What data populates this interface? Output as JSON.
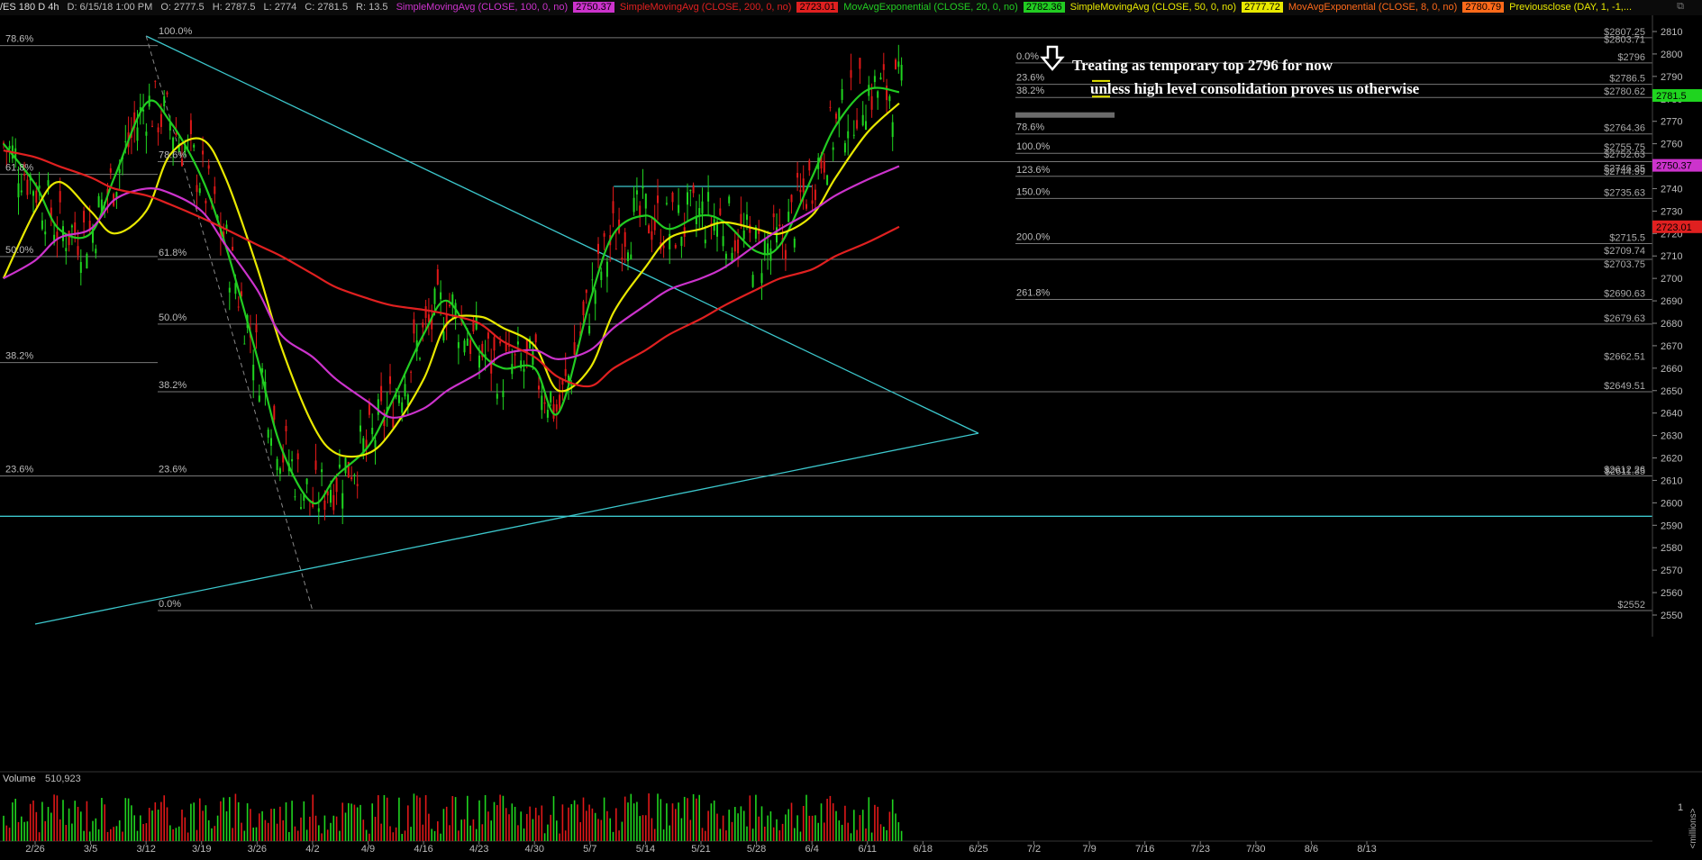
{
  "header": {
    "symbol": "/ES 180 D 4h",
    "date": "D: 6/15/18 1:00 PM",
    "open": "O: 2777.5",
    "high": "H: 2787.5",
    "low": "L: 2774",
    "close": "C: 2781.5",
    "range": "R: 13.5",
    "studies": [
      {
        "label": "SimpleMovingAvg (CLOSE, 100, 0, no)",
        "value": "2750.37",
        "color": "#cc33cc"
      },
      {
        "label": "SimpleMovingAvg (CLOSE, 200, 0, no)",
        "value": "2723.01",
        "color": "#e02020"
      },
      {
        "label": "MovAvgExponential (CLOSE, 20, 0, no)",
        "value": "2782.36",
        "color": "#22cc22"
      },
      {
        "label": "SimpleMovingAvg (CLOSE, 50, 0, no)",
        "value": "2777.72",
        "color": "#e8e800"
      },
      {
        "label": "MovAvgExponential (CLOSE, 8, 0, no)",
        "value": "2780.79",
        "color": "#ff6a1a"
      },
      {
        "label": "Previousclose (DAY, 1, -1,...",
        "value": "",
        "color": "#e8e800"
      }
    ]
  },
  "annotations": {
    "line1": "Treating as temporary top 2796 for now",
    "line2": "unless high level consolidation proves us otherwise"
  },
  "chart_data": {
    "type": "candlestick",
    "symbol": "/ES",
    "timeframe": "180 D 4h",
    "ylim": [
      2545,
      2812
    ],
    "ohlc_last": {
      "open": 2777.5,
      "high": 2787.5,
      "low": 2774,
      "close": 2781.5,
      "range": 13.5
    },
    "y_ticks": [
      2550,
      2560,
      2570,
      2580,
      2590,
      2600,
      2610,
      2620,
      2630,
      2640,
      2650,
      2660,
      2670,
      2680,
      2690,
      2700,
      2710,
      2720,
      2730,
      2740,
      2750,
      2760,
      2770,
      2780,
      2790,
      2800,
      2810
    ],
    "x_labels": [
      "2/26",
      "3/5",
      "3/12",
      "3/19",
      "3/26",
      "4/2",
      "4/9",
      "4/16",
      "4/23",
      "4/30",
      "5/7",
      "5/14",
      "5/21",
      "5/28",
      "6/4",
      "6/11",
      "6/18",
      "6/25",
      "7/2",
      "7/9",
      "7/16",
      "7/23",
      "7/30",
      "8/6",
      "8/13"
    ],
    "price_badges": [
      {
        "value": "2781.5",
        "price": 2781.5,
        "color": "#1fd41f"
      },
      {
        "value": "2750.37",
        "price": 2750.37,
        "color": "#cc33cc"
      },
      {
        "value": "2723.01",
        "price": 2723.01,
        "color": "#e02020"
      }
    ],
    "series": [
      {
        "name": "EMA 20",
        "color": "#22cc22",
        "points": [
          [
            "2/22",
            2760
          ],
          [
            "2/26",
            2742
          ],
          [
            "3/1",
            2722
          ],
          [
            "3/5",
            2720
          ],
          [
            "3/8",
            2745
          ],
          [
            "3/12",
            2778
          ],
          [
            "3/15",
            2770
          ],
          [
            "3/19",
            2745
          ],
          [
            "3/22",
            2715
          ],
          [
            "3/26",
            2665
          ],
          [
            "3/29",
            2625
          ],
          [
            "4/2",
            2600
          ],
          [
            "4/5",
            2612
          ],
          [
            "4/9",
            2625
          ],
          [
            "4/12",
            2645
          ],
          [
            "4/16",
            2675
          ],
          [
            "4/19",
            2690
          ],
          [
            "4/23",
            2668
          ],
          [
            "4/26",
            2660
          ],
          [
            "4/30",
            2660
          ],
          [
            "5/3",
            2640
          ],
          [
            "5/7",
            2690
          ],
          [
            "5/10",
            2720
          ],
          [
            "5/14",
            2728
          ],
          [
            "5/17",
            2722
          ],
          [
            "5/21",
            2728
          ],
          [
            "5/24",
            2725
          ],
          [
            "5/28",
            2712
          ],
          [
            "5/31",
            2715
          ],
          [
            "6/4",
            2745
          ],
          [
            "6/7",
            2768
          ],
          [
            "6/11",
            2784
          ],
          [
            "6/15",
            2783
          ]
        ]
      },
      {
        "name": "SMA 50",
        "color": "#e8e800",
        "points": [
          [
            "2/22",
            2700
          ],
          [
            "2/26",
            2730
          ],
          [
            "3/1",
            2743
          ],
          [
            "3/5",
            2730
          ],
          [
            "3/8",
            2720
          ],
          [
            "3/12",
            2730
          ],
          [
            "3/15",
            2755
          ],
          [
            "3/19",
            2762
          ],
          [
            "3/22",
            2745
          ],
          [
            "3/26",
            2705
          ],
          [
            "3/29",
            2670
          ],
          [
            "4/2",
            2635
          ],
          [
            "4/5",
            2622
          ],
          [
            "4/9",
            2622
          ],
          [
            "4/12",
            2632
          ],
          [
            "4/16",
            2655
          ],
          [
            "4/19",
            2680
          ],
          [
            "4/23",
            2683
          ],
          [
            "4/26",
            2678
          ],
          [
            "4/30",
            2670
          ],
          [
            "5/3",
            2650
          ],
          [
            "5/7",
            2660
          ],
          [
            "5/10",
            2685
          ],
          [
            "5/14",
            2705
          ],
          [
            "5/17",
            2718
          ],
          [
            "5/21",
            2722
          ],
          [
            "5/24",
            2725
          ],
          [
            "5/28",
            2722
          ],
          [
            "5/31",
            2720
          ],
          [
            "6/4",
            2728
          ],
          [
            "6/7",
            2745
          ],
          [
            "6/11",
            2765
          ],
          [
            "6/15",
            2778
          ]
        ]
      },
      {
        "name": "SMA 100",
        "color": "#cc33cc",
        "points": [
          [
            "2/22",
            2700
          ],
          [
            "2/26",
            2708
          ],
          [
            "3/1",
            2718
          ],
          [
            "3/5",
            2722
          ],
          [
            "3/8",
            2735
          ],
          [
            "3/12",
            2740
          ],
          [
            "3/15",
            2738
          ],
          [
            "3/19",
            2730
          ],
          [
            "3/22",
            2715
          ],
          [
            "3/26",
            2695
          ],
          [
            "3/29",
            2675
          ],
          [
            "4/2",
            2665
          ],
          [
            "4/5",
            2655
          ],
          [
            "4/9",
            2645
          ],
          [
            "4/12",
            2638
          ],
          [
            "4/16",
            2642
          ],
          [
            "4/19",
            2650
          ],
          [
            "4/23",
            2658
          ],
          [
            "4/26",
            2666
          ],
          [
            "4/30",
            2668
          ],
          [
            "5/3",
            2664
          ],
          [
            "5/7",
            2668
          ],
          [
            "5/10",
            2678
          ],
          [
            "5/14",
            2688
          ],
          [
            "5/17",
            2695
          ],
          [
            "5/21",
            2700
          ],
          [
            "5/24",
            2705
          ],
          [
            "5/28",
            2715
          ],
          [
            "5/31",
            2722
          ],
          [
            "6/4",
            2730
          ],
          [
            "6/7",
            2737
          ],
          [
            "6/11",
            2744
          ],
          [
            "6/15",
            2750
          ]
        ]
      },
      {
        "name": "SMA 200",
        "color": "#e02020",
        "points": [
          [
            "2/22",
            2757
          ],
          [
            "2/26",
            2754
          ],
          [
            "3/1",
            2750
          ],
          [
            "3/5",
            2745
          ],
          [
            "3/8",
            2740
          ],
          [
            "3/12",
            2737
          ],
          [
            "3/15",
            2733
          ],
          [
            "3/19",
            2727
          ],
          [
            "3/22",
            2722
          ],
          [
            "3/26",
            2715
          ],
          [
            "3/29",
            2710
          ],
          [
            "4/2",
            2702
          ],
          [
            "4/5",
            2696
          ],
          [
            "4/9",
            2691
          ],
          [
            "4/12",
            2688
          ],
          [
            "4/16",
            2686
          ],
          [
            "4/19",
            2684
          ],
          [
            "4/23",
            2680
          ],
          [
            "4/26",
            2672
          ],
          [
            "4/30",
            2665
          ],
          [
            "5/3",
            2656
          ],
          [
            "5/7",
            2652
          ],
          [
            "5/10",
            2660
          ],
          [
            "5/14",
            2668
          ],
          [
            "5/17",
            2675
          ],
          [
            "5/21",
            2682
          ],
          [
            "5/24",
            2688
          ],
          [
            "5/28",
            2695
          ],
          [
            "5/31",
            2700
          ],
          [
            "6/4",
            2704
          ],
          [
            "6/7",
            2710
          ],
          [
            "6/11",
            2716
          ],
          [
            "6/15",
            2723
          ]
        ]
      }
    ],
    "fib_levels": [
      {
        "label": "100.0%",
        "price": 2807.25
      },
      {
        "label": "78.6%",
        "price": 2752
      },
      {
        "label": "61.8%",
        "price": 2708.5
      },
      {
        "label": "50.0%",
        "price": 2679.63
      },
      {
        "label": "38.2%",
        "price": 2649.51
      },
      {
        "label": "23.6%",
        "price": 2612
      },
      {
        "label": "0.0%",
        "price": 2552
      },
      {
        "label": "0.0%",
        "price": 2796
      },
      {
        "label": "23.6%",
        "price": 2786.5
      },
      {
        "label": "38.2%",
        "price": 2780.62
      },
      {
        "label": "78.6%",
        "price": 2764.36
      },
      {
        "label": "100.0%",
        "price": 2755.75
      },
      {
        "label": "123.6%",
        "price": 2745.5
      },
      {
        "label": "150.0%",
        "price": 2735.63
      },
      {
        "label": "200.0%",
        "price": 2715.5
      },
      {
        "label": "261.8%",
        "price": 2690.63
      }
    ],
    "left_fib_labels": [
      {
        "label": "78.6%",
        "price": 2803.71
      },
      {
        "label": "61.8%",
        "price": 2746.35
      },
      {
        "label": "50.0%",
        "price": 2709.74
      },
      {
        "label": "38.2%",
        "price": 2662.51
      },
      {
        "label": "23.6%",
        "price": 2612
      }
    ],
    "price_labels": [
      {
        "label": "$2807.25",
        "price": 2807.25
      },
      {
        "label": "$2803.71",
        "price": 2803.71
      },
      {
        "label": "$2796",
        "price": 2796
      },
      {
        "label": "$2786.5",
        "price": 2786.5
      },
      {
        "label": "$2780.62",
        "price": 2780.62
      },
      {
        "label": "$2764.36",
        "price": 2764.36
      },
      {
        "label": "$2755.75",
        "price": 2755.75
      },
      {
        "label": "$2752.63",
        "price": 2752.63
      },
      {
        "label": "$2746.35",
        "price": 2746.35
      },
      {
        "label": "$2744.99",
        "price": 2744.99
      },
      {
        "label": "$2735.63",
        "price": 2735.63
      },
      {
        "label": "$2715.5",
        "price": 2715.5
      },
      {
        "label": "$2709.74",
        "price": 2709.74
      },
      {
        "label": "$2703.75",
        "price": 2703.75
      },
      {
        "label": "$2690.63",
        "price": 2690.63
      },
      {
        "label": "$2679.63",
        "price": 2679.63
      },
      {
        "label": "$2662.51",
        "price": 2662.51
      },
      {
        "label": "$2649.51",
        "price": 2649.51
      },
      {
        "label": "$2612.26",
        "price": 2612.26
      },
      {
        "label": "$2611.35",
        "price": 2611.35
      },
      {
        "label": "$2552",
        "price": 2552
      }
    ],
    "trendlines": [
      {
        "name": "descending",
        "from": [
          "3/12",
          2808
        ],
        "to": [
          "6/25",
          2631
        ]
      },
      {
        "name": "ascending",
        "from": [
          "2/26",
          2546
        ],
        "to": [
          "6/25",
          2631
        ]
      },
      {
        "name": "range-top",
        "from": [
          "5/10",
          2741
        ],
        "to": [
          "6/4",
          2741
        ]
      }
    ],
    "hlines": [
      2594
    ],
    "volume": {
      "label": "Volume",
      "value": "510,923",
      "axis_label": "1",
      "units": "<millions>"
    }
  }
}
